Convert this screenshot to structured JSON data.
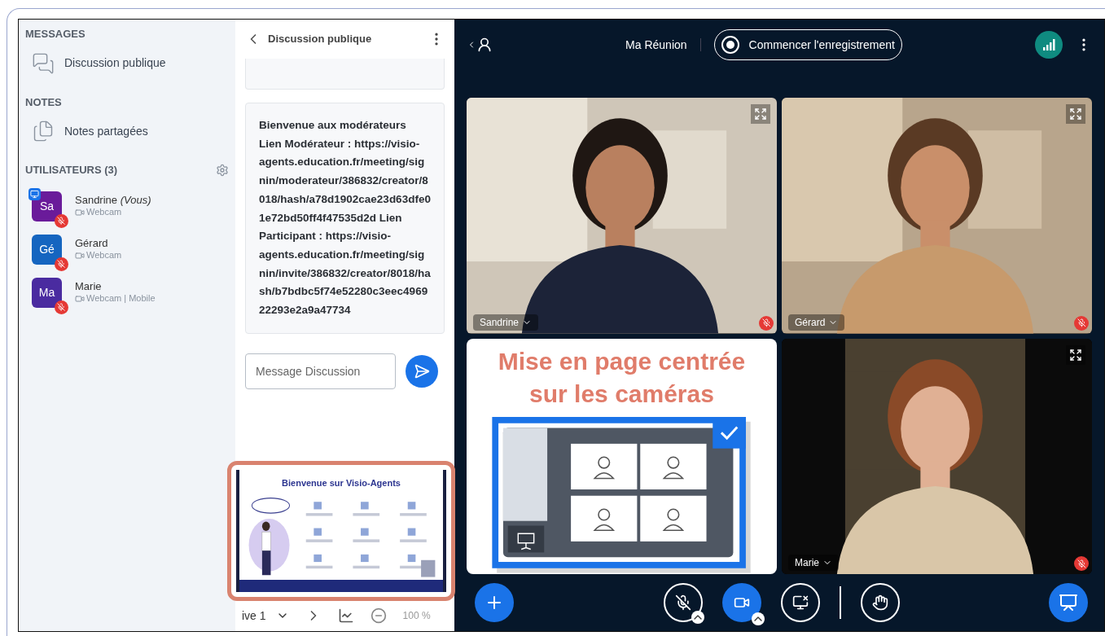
{
  "sidebar": {
    "messages": {
      "title": "MESSAGES",
      "item": "Discussion publique"
    },
    "notes": {
      "title": "NOTES",
      "item": "Notes partagées"
    },
    "users": {
      "title": "UTILISATEURS (3)",
      "list": [
        {
          "initials": "Sa",
          "name": "Sandrine",
          "suffix": "(Vous)",
          "status": "Webcam",
          "color": "#6a1b9a",
          "presenter": true,
          "muted": true
        },
        {
          "initials": "Gé",
          "name": "Gérard",
          "status": "Webcam",
          "color": "#1565c0",
          "presenter": false,
          "muted": true
        },
        {
          "initials": "Ma",
          "name": "Marie",
          "status": "Webcam | Mobile",
          "color": "#4a2ba0",
          "presenter": false,
          "muted": true
        }
      ]
    }
  },
  "chat": {
    "title": "Discussion publique",
    "message": "Bienvenue aux modérateurs Lien Modérateur : https://visio-agents.education.fr/meeting/signin/moderateur/386832/creator/8018/hash/a78d1902cae23d63dfe01e72bd50ff4f47535d2d Lien Participant : https://visio-agents.education.fr/meeting/signin/invite/386832/creator/8018/hash/b7bdbc5f74e52280c3eec496922293e2a9a47734",
    "placeholder": "Message Discussion"
  },
  "presentation": {
    "slide_title": "Bienvenue sur Visio-Agents",
    "slide_label": "ive 1",
    "zoom": "100 %"
  },
  "topbar": {
    "meeting": "Ma Réunion",
    "record": "Commencer l'enregistrement"
  },
  "tiles": [
    {
      "kind": "camera",
      "name": "Sandrine",
      "muted": true
    },
    {
      "kind": "camera",
      "name": "Gérard",
      "muted": true
    },
    {
      "kind": "layout",
      "title": "Mise en page centrée sur les caméras"
    },
    {
      "kind": "camera",
      "name": "Marie",
      "muted": true
    }
  ],
  "controls": {
    "mic_on": false,
    "camera_on": true,
    "screen_on": false
  }
}
